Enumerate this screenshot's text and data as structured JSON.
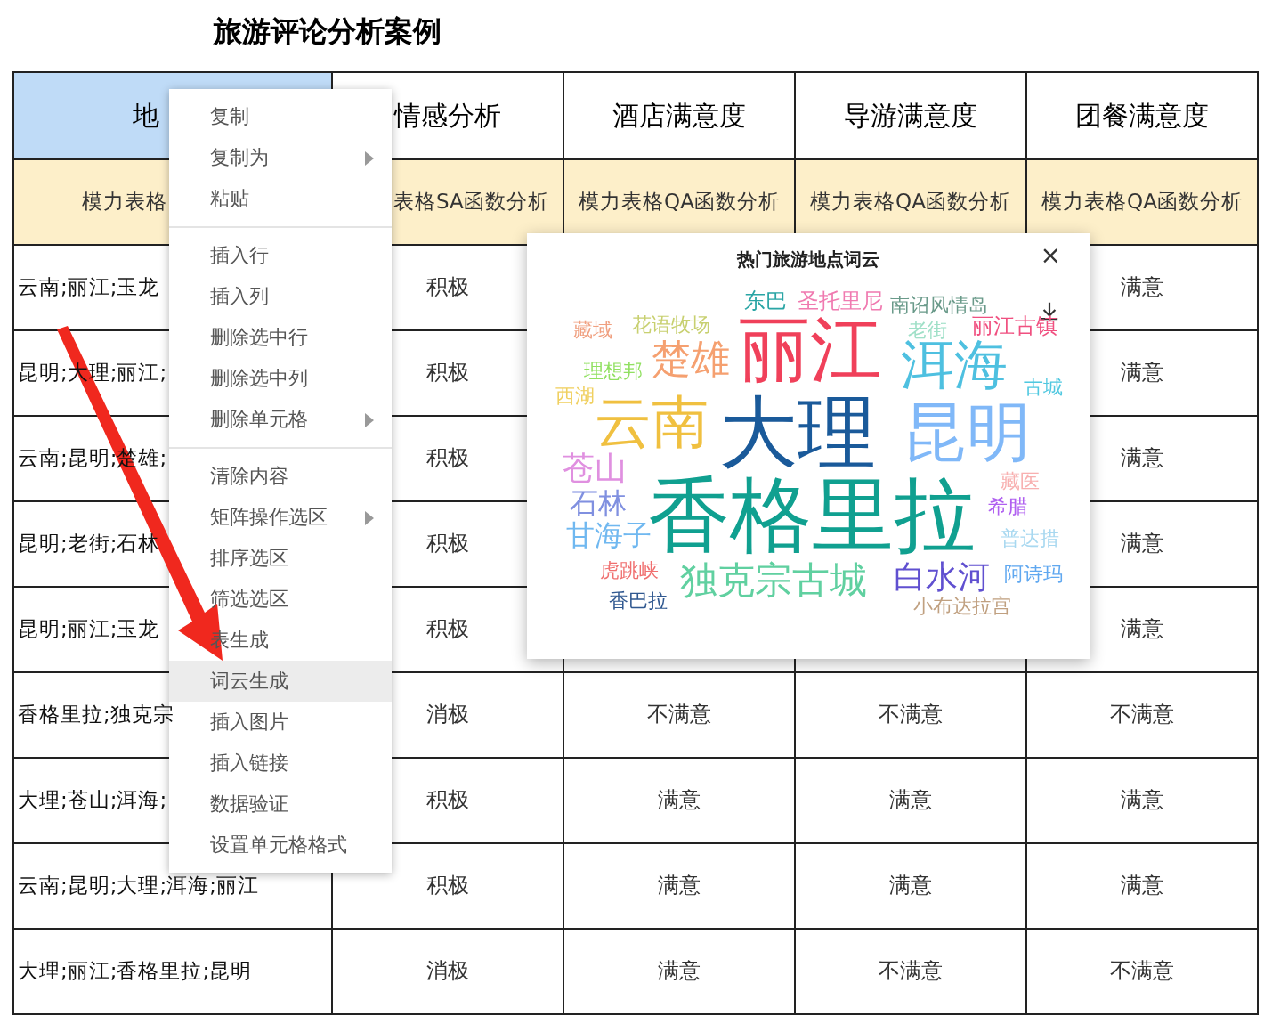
{
  "title": "旅游评论分析案例",
  "table": {
    "columns": [
      {
        "label": "地",
        "selected": true
      },
      {
        "label": "情感分析",
        "selected": false
      },
      {
        "label": "酒店满意度",
        "selected": false
      },
      {
        "label": "导游满意度",
        "selected": false
      },
      {
        "label": "团餐满意度",
        "selected": false
      }
    ],
    "subheaders": [
      "模力表格",
      "表格SA函数分析",
      "模力表格QA函数分析",
      "模力表格QA函数分析",
      "模力表格QA函数分析"
    ],
    "rows": [
      [
        "云南;丽江;玉龙",
        "积极",
        null,
        null,
        "满意"
      ],
      [
        "昆明;大理;丽江;",
        "积极",
        null,
        null,
        "满意"
      ],
      [
        "云南;昆明;楚雄;",
        "积极",
        null,
        null,
        "满意"
      ],
      [
        "昆明;老街;石林",
        "积极",
        null,
        null,
        "满意"
      ],
      [
        "昆明;丽江;玉龙",
        "积极",
        null,
        null,
        "满意"
      ],
      [
        "香格里拉;独克宗",
        "消极",
        "不满意",
        "不满意",
        "不满意"
      ],
      [
        "大理;苍山;洱海;",
        "积极",
        "满意",
        "满意",
        "满意"
      ],
      [
        "云南;昆明;大理;洱海;丽江",
        "积极",
        "满意",
        "满意",
        "满意"
      ],
      [
        "大理;丽江;香格里拉;昆明",
        "消极",
        "满意",
        "不满意",
        "不满意"
      ]
    ]
  },
  "context_menu": {
    "items": [
      {
        "kind": "item",
        "label": "复制",
        "submenu": false,
        "selected": false
      },
      {
        "kind": "item",
        "label": "复制为",
        "submenu": true,
        "selected": false
      },
      {
        "kind": "item",
        "label": "粘贴",
        "submenu": false,
        "selected": false
      },
      {
        "kind": "separator"
      },
      {
        "kind": "item",
        "label": "插入行",
        "submenu": false,
        "selected": false
      },
      {
        "kind": "item",
        "label": "插入列",
        "submenu": false,
        "selected": false
      },
      {
        "kind": "item",
        "label": "删除选中行",
        "submenu": false,
        "selected": false
      },
      {
        "kind": "item",
        "label": "删除选中列",
        "submenu": false,
        "selected": false
      },
      {
        "kind": "item",
        "label": "删除单元格",
        "submenu": true,
        "selected": false
      },
      {
        "kind": "separator"
      },
      {
        "kind": "item",
        "label": "清除内容",
        "submenu": false,
        "selected": false
      },
      {
        "kind": "item",
        "label": "矩阵操作选区",
        "submenu": true,
        "selected": false
      },
      {
        "kind": "item",
        "label": "排序选区",
        "submenu": false,
        "selected": false
      },
      {
        "kind": "item",
        "label": "筛选选区",
        "submenu": false,
        "selected": false
      },
      {
        "kind": "item",
        "label": "表生成",
        "submenu": false,
        "selected": false
      },
      {
        "kind": "item",
        "label": "词云生成",
        "submenu": false,
        "selected": true
      },
      {
        "kind": "item",
        "label": "插入图片",
        "submenu": false,
        "selected": false
      },
      {
        "kind": "item",
        "label": "插入链接",
        "submenu": false,
        "selected": false
      },
      {
        "kind": "item",
        "label": "数据验证",
        "submenu": false,
        "selected": false
      },
      {
        "kind": "item",
        "label": "设置单元格格式",
        "submenu": false,
        "selected": false
      }
    ]
  },
  "word_cloud_dialog": {
    "title": "热门旅游地点词云",
    "close": "×",
    "words": [
      {
        "text": "东巴",
        "color": "#2aa5a5"
      },
      {
        "text": "圣托里尼",
        "color": "#f07ab0"
      },
      {
        "text": "南诏风情岛",
        "color": "#6a9a8a"
      },
      {
        "text": "西湖",
        "color": "#f0d060"
      },
      {
        "text": "藏域",
        "color": "#f0a080"
      },
      {
        "text": "理想邦",
        "color": "#90e060"
      },
      {
        "text": "花语牧场",
        "color": "#c8d070"
      },
      {
        "text": "楚雄",
        "color": "#f5a070"
      },
      {
        "text": "丽江",
        "color": "#f0405a"
      },
      {
        "text": "老街",
        "color": "#a0e0c8"
      },
      {
        "text": "洱海",
        "color": "#4ec0e0"
      },
      {
        "text": "丽江古镇",
        "color": "#f05080"
      },
      {
        "text": "古城",
        "color": "#50c8e0"
      },
      {
        "text": "云南",
        "color": "#f0c040"
      },
      {
        "text": "大理",
        "color": "#1a5a9a"
      },
      {
        "text": "昆明",
        "color": "#80b8f8"
      },
      {
        "text": "苍山",
        "color": "#e090e0"
      },
      {
        "text": "石林",
        "color": "#8090e0"
      },
      {
        "text": "甘海子",
        "color": "#70b8f0"
      },
      {
        "text": "香格里拉",
        "color": "#10a090"
      },
      {
        "text": "藏医",
        "color": "#f8b0b0"
      },
      {
        "text": "希腊",
        "color": "#b060f0"
      },
      {
        "text": "普达措",
        "color": "#a8d8f0"
      },
      {
        "text": "虎跳峡",
        "color": "#f07070"
      },
      {
        "text": "独克宗古城",
        "color": "#60d0a0"
      },
      {
        "text": "白水河",
        "color": "#6050d0"
      },
      {
        "text": "阿诗玛",
        "color": "#60a8f0"
      },
      {
        "text": "香巴拉",
        "color": "#305890"
      },
      {
        "text": "小布达拉宫",
        "color": "#c0a080"
      }
    ]
  }
}
